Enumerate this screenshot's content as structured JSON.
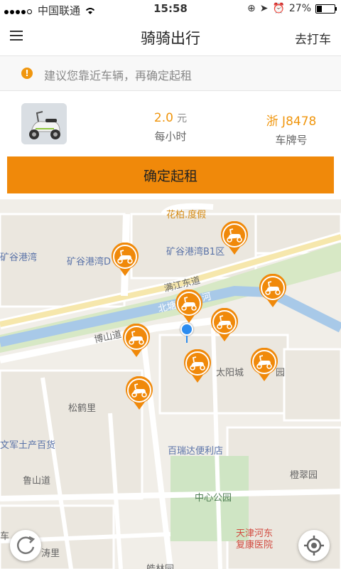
{
  "status_bar": {
    "carrier": "中国联通",
    "time": "15:58",
    "battery": "27%"
  },
  "navbar": {
    "title": "骑骑出行",
    "right_label": "去打车"
  },
  "tip": {
    "icon": "!",
    "text": "建议您靠近车辆，再确定起租"
  },
  "vehicle": {
    "price_value": "2.0",
    "price_unit": "元",
    "price_label": "每小时",
    "plate_value": "浙 J8478",
    "plate_label": "车牌号"
  },
  "confirm_label": "确定起租",
  "map": {
    "labels": {
      "huabo": "花柏.度假",
      "kuanggu_left": "矿谷港湾",
      "kuanggu_d": "矿谷港湾D",
      "kuanggu_b1": "矿谷港湾B1区",
      "manjiang": "满江东道",
      "beitang": "北塘",
      "he": "河",
      "boshan": "博山道",
      "taiyang_a": "太阳城",
      "taiyang_b": "园",
      "songhe": "松鹤里",
      "wenjun": "文军土产百货",
      "bairuida": "百瑞达便利店",
      "lushan": "鲁山道",
      "chengcui": "橙翠园",
      "zhongxin": "中心公园",
      "hospital_a": "天津河东",
      "hospital_b": "复康医院",
      "taoli": "涛里",
      "che": "车",
      "haolin": "皓林园"
    },
    "pins": [
      "scooter-pin",
      "scooter-pin",
      "scooter-pin",
      "scooter-pin",
      "scooter-pin",
      "scooter-pin",
      "scooter-pin",
      "scooter-pin",
      "scooter-pin"
    ],
    "accent_color": "#f0890a"
  }
}
